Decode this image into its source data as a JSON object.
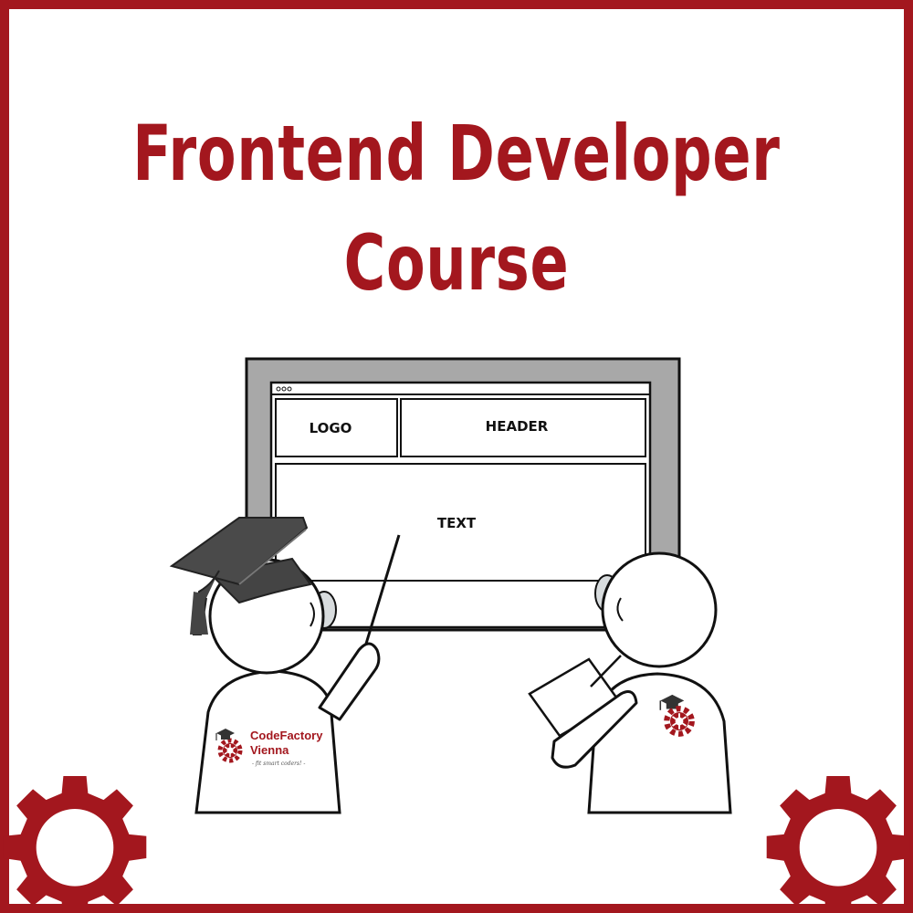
{
  "title": {
    "line1": "Frontend Developer",
    "line2": "Course"
  },
  "wireframe": {
    "logo_label": "LOGO",
    "header_label": "HEADER",
    "text_label": "TEXT"
  },
  "brand": {
    "line1": "CodeFactory",
    "line2": "Vienna",
    "slogan": "- fit smart coders! -"
  },
  "colors": {
    "accent": "#a3171e",
    "board_gray": "#a8a8a8",
    "cap_gray": "#444444"
  }
}
